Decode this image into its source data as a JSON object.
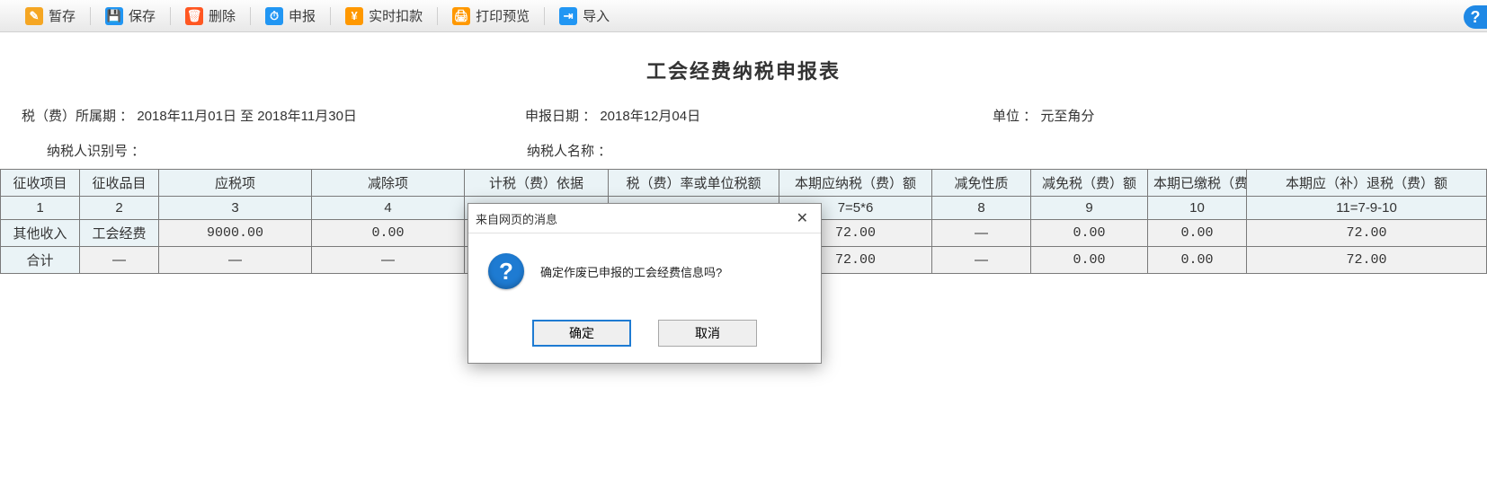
{
  "toolbar": {
    "stash": "暂存",
    "save": "保存",
    "delete": "删除",
    "declare": "申报",
    "deduct": "实时扣款",
    "print": "打印预览",
    "import": "导入"
  },
  "help_badge": "?",
  "title": "工会经费纳税申报表",
  "meta": {
    "period_label": "税（费）所属期 ：",
    "period_value": "2018年11月01日 至 2018年11月30日",
    "declare_label": "申报日期 ：",
    "declare_value": "2018年12月04日",
    "unit_label": "单位 ：",
    "unit_value": "元至角分",
    "taxno_label": "纳税人识别号 ：",
    "taxno_value": "",
    "taxname_label": "纳税人名称 ：",
    "taxname_value": ""
  },
  "table": {
    "headers": {
      "c1": "征收项目",
      "c2": "征收品目",
      "c3": "应税项",
      "c4": "减除项",
      "c5": "计税（费）依据",
      "c6": "税（费）率或单位税额",
      "c7": "本期应纳税（费）额",
      "c8": "减免性质",
      "c9": "减免税（费）额",
      "c10": "本期已缴税（费）额",
      "c11": "本期应（补）退税（费）额"
    },
    "formula": {
      "c1": "1",
      "c2": "2",
      "c3": "3",
      "c4": "4",
      "c7": "7=5*6",
      "c8": "8",
      "c9": "9",
      "c10": "10",
      "c11": "11=7-9-10"
    },
    "row": {
      "c1": "其他收入",
      "c2": "工会经费",
      "c3": "9000.00",
      "c4": "0.00",
      "c7": "72.00",
      "c8": "—",
      "c9": "0.00",
      "c10": "0.00",
      "c11": "72.00"
    },
    "total": {
      "c1": "合计",
      "c2": "—",
      "c3": "—",
      "c4": "—",
      "c7": "72.00",
      "c8": "—",
      "c9": "0.00",
      "c10": "0.00",
      "c11": "72.00"
    }
  },
  "modal": {
    "title": "来自网页的消息",
    "message": "确定作废已申报的工会经费信息吗?",
    "ok": "确定",
    "cancel": "取消"
  }
}
